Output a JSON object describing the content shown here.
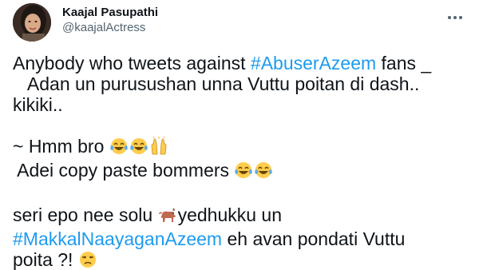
{
  "author": {
    "display_name": "Kaajal Pasupathi",
    "handle": "@kaajalActress",
    "avatar_icon": "profile-photo"
  },
  "more_icon": "more-options-icon",
  "tweet": {
    "p1_l1_a": "Anybody who tweets against ",
    "p1_l1_tag": "#AbuserAzeem",
    "p1_l1_b": " fans _",
    "p1_l2": "   Adan un purusushan unna Vuttu poitan di dash..",
    "p1_l3": "kikiki..",
    "p2_l1": "~ Hmm bro ",
    "p2_l2": " Adei copy paste bommers ",
    "p3_l1_a": "seri epo nee solu ",
    "p3_l1_b": "yedhukku un",
    "p3_l2_tag": "#MakkalNaayaganAzeem",
    "p3_l2_b": " eh avan pondati Vuttu",
    "p3_l3": "poita ?! "
  },
  "emoji_names": [
    "tears-of-joy-emoji",
    "raising-hands-emoji",
    "dog-emoji",
    "unamused-face-emoji"
  ],
  "colors": {
    "hashtag": "#1d9bf0",
    "text": "#0f1419",
    "secondary": "#536471"
  }
}
